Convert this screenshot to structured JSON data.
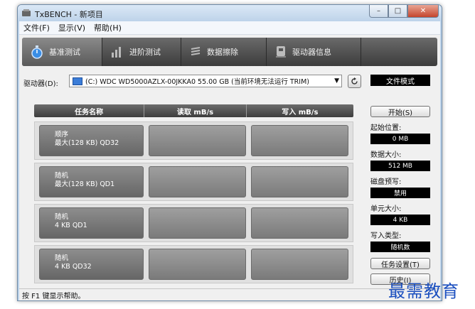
{
  "window": {
    "title": "TxBENCH - 新项目"
  },
  "window_buttons": {
    "minimize": "–",
    "maximize": "□",
    "close": "✕"
  },
  "menu": [
    "文件(F)",
    "显示(V)",
    "帮助(H)"
  ],
  "tabs": [
    {
      "label": "基准测试",
      "icon": "stopwatch-icon",
      "active": true
    },
    {
      "label": "进阶测试",
      "icon": "bar-chart-icon",
      "active": false
    },
    {
      "label": "数据擦除",
      "icon": "erase-icon",
      "active": false
    },
    {
      "label": "驱动器信息",
      "icon": "drive-info-icon",
      "active": false
    }
  ],
  "drive": {
    "label": "驱动器(D):",
    "selected": "(C:) WDC WD5000AZLX-00JKKA0  55.00 GB (当前环境无法运行 TRIM)",
    "mode_button": "文件模式"
  },
  "grid": {
    "headers": [
      "任务名称",
      "读取 mB/s",
      "写入 mB/s"
    ],
    "rows": [
      {
        "line1": "顺序",
        "line2": "最大(128 KB) QD32",
        "read": "",
        "write": ""
      },
      {
        "line1": "随机",
        "line2": "最大(128 KB) QD1",
        "read": "",
        "write": ""
      },
      {
        "line1": "随机",
        "line2": "4 KB QD1",
        "read": "",
        "write": ""
      },
      {
        "line1": "随机",
        "line2": "4 KB QD32",
        "read": "",
        "write": ""
      }
    ]
  },
  "side": {
    "start_button": "开始(S)",
    "start_pos_label": "起始位置:",
    "start_pos_value": "0 MB",
    "data_size_label": "数据大小:",
    "data_size_value": "512 MB",
    "prewrite_label": "磁盘预写:",
    "prewrite_value": "禁用",
    "unit_size_label": "单元大小:",
    "unit_size_value": "4 KB",
    "write_type_label": "写入类型:",
    "write_type_value": "随机数",
    "task_settings_button": "任务设置(T)",
    "history_button": "历史(I)"
  },
  "status": {
    "text": "按 F1 键显示帮助。"
  },
  "watermark": "最需教育"
}
